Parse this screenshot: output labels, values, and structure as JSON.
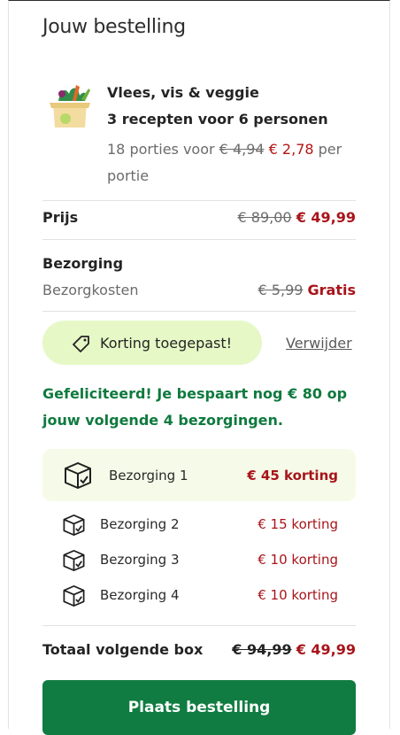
{
  "header": {
    "title": "Jouw bestelling"
  },
  "plan": {
    "name": "Vlees, vis & veggie",
    "recipes": "3 recepten voor 6 personen",
    "portions_prefix": "18 porties voor",
    "portion_old_price": "€ 4,94",
    "portion_new_price": "€ 2,78",
    "portion_suffix": "per portie"
  },
  "price": {
    "label": "Prijs",
    "old": "€ 89,00",
    "new": "€ 49,99"
  },
  "shipping": {
    "label": "Bezorging",
    "cost_label": "Bezorgkosten",
    "old": "€ 5,99",
    "new": "Gratis"
  },
  "coupon": {
    "label": "Korting toegepast!",
    "remove": "Verwijder"
  },
  "congrats": "Gefeliciteerd! Je bespaart nog € 80 op jouw volgende 4 bezorgingen.",
  "deliveries": [
    {
      "label": "Bezorging 1",
      "discount": "€ 45 korting"
    },
    {
      "label": "Bezorging 2",
      "discount": "€ 15 korting"
    },
    {
      "label": "Bezorging 3",
      "discount": "€ 10 korting"
    },
    {
      "label": "Bezorging 4",
      "discount": "€ 10 korting"
    }
  ],
  "total": {
    "label": "Totaal volgende box",
    "old": "€ 94,99",
    "new": "€ 49,99"
  },
  "cta": {
    "label": "Plaats bestelling"
  },
  "colors": {
    "green": "#107c41",
    "red": "#a8141a",
    "pill": "#e5f8c6",
    "highlight": "#f5fbe8"
  }
}
